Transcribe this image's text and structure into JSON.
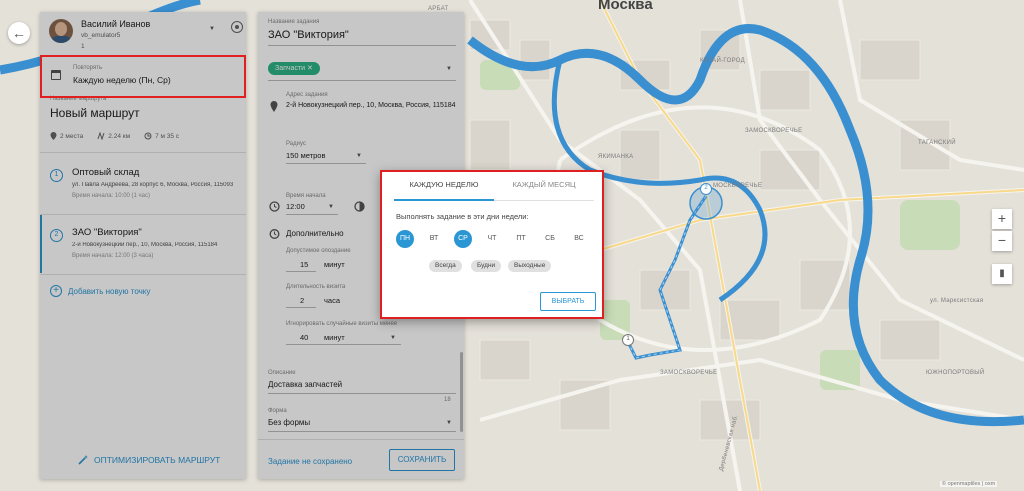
{
  "map": {
    "city_label": "Москва",
    "street_labels": [
      "АРБАТ",
      "ЯКИМАНКА",
      "ЗАМОСКВОРЕЧЬЕ",
      "КИТАЙ-ГОРОД",
      "ТАГАНСКИЙ",
      "ЗАМОСКВОРЕЧЬЕ",
      "МОСКВОРЕЧЬЕ",
      "ЮЖНОПОРТОВЫЙ",
      "ул. Марксистская",
      "Дербеневская наб."
    ],
    "credits": "© openmaptiles | osm",
    "markers": [
      "1",
      "2"
    ],
    "colors": {
      "water": "#3a8fd0",
      "road": "#f5f3ee",
      "route": "#3a8fd0",
      "park": "#c9dcb8"
    }
  },
  "nav": {
    "back_icon": "arrow-left-icon"
  },
  "user": {
    "name": "Василий Иванов",
    "login": "vb_emulator5",
    "count": "1"
  },
  "repeat": {
    "label": "Повторять",
    "value": "Каждую неделю (Пн, Ср)"
  },
  "route": {
    "label": "Название маршрута",
    "name": "Новый маршрут",
    "stats": {
      "places": "2 места",
      "distance": "2.24 км",
      "duration": "7 м 35 с"
    }
  },
  "stops": [
    {
      "num": "1",
      "title": "Оптовый склад",
      "address": "ул. Павла Андреева, 28 корпус 6, Москва, Россия, 115093",
      "start": "Время начала: 10:00 (1 час)"
    },
    {
      "num": "2",
      "title": "ЗАО \"Виктория\"",
      "address": "2-й Новокузнецкий пер., 10, Москва, Россия, 115184",
      "start": "Время начала: 12:00 (3 часа)"
    }
  ],
  "add_point": "Добавить новую точку",
  "optimize": "ОПТИМИЗИРОВАТЬ МАРШРУТ",
  "task": {
    "name_label": "Название задания",
    "name": "ЗАО \"Виктория\"",
    "tag": "Запчасти",
    "address_label": "Адрес задания",
    "address": "2-й Новокузнецкий пер., 10, Москва, Россия, 115184",
    "radius_label": "Радиус",
    "radius": "150 метров",
    "start_label": "Время начала",
    "start": "12:00",
    "extra_label": "Дополнительно",
    "delay_label": "Допустимое опоздание",
    "delay_value": "15",
    "delay_unit": "минут",
    "duration_label": "Длительность визита",
    "duration_value": "2",
    "duration_unit": "часа",
    "ignore_label": "Игнорировать случайные визиты менее",
    "ignore_value": "40",
    "ignore_unit": "минут",
    "desc_label": "Описание",
    "desc": "Доставка запчастей",
    "desc_counter": "18",
    "form_label": "Форма",
    "form": "Без формы",
    "status": "Задание не сохранено",
    "save": "СОХРАНИТЬ"
  },
  "zoom": {
    "in": "+",
    "out": "−"
  },
  "dialog": {
    "tab_weekly": "КАЖДУЮ НЕДЕЛЮ",
    "tab_monthly": "КАЖДЫЙ МЕСЯЦ",
    "prompt": "Выполнять задание в эти дни недели:",
    "days": [
      {
        "label": "ПН",
        "selected": true
      },
      {
        "label": "ВТ",
        "selected": false
      },
      {
        "label": "СР",
        "selected": true
      },
      {
        "label": "ЧТ",
        "selected": false
      },
      {
        "label": "ПТ",
        "selected": false
      },
      {
        "label": "СБ",
        "selected": false
      },
      {
        "label": "ВС",
        "selected": false
      }
    ],
    "presets": [
      "Всегда",
      "Будни",
      "Выходные"
    ],
    "confirm": "ВЫБРАТЬ",
    "accent": "#2a96d4"
  }
}
